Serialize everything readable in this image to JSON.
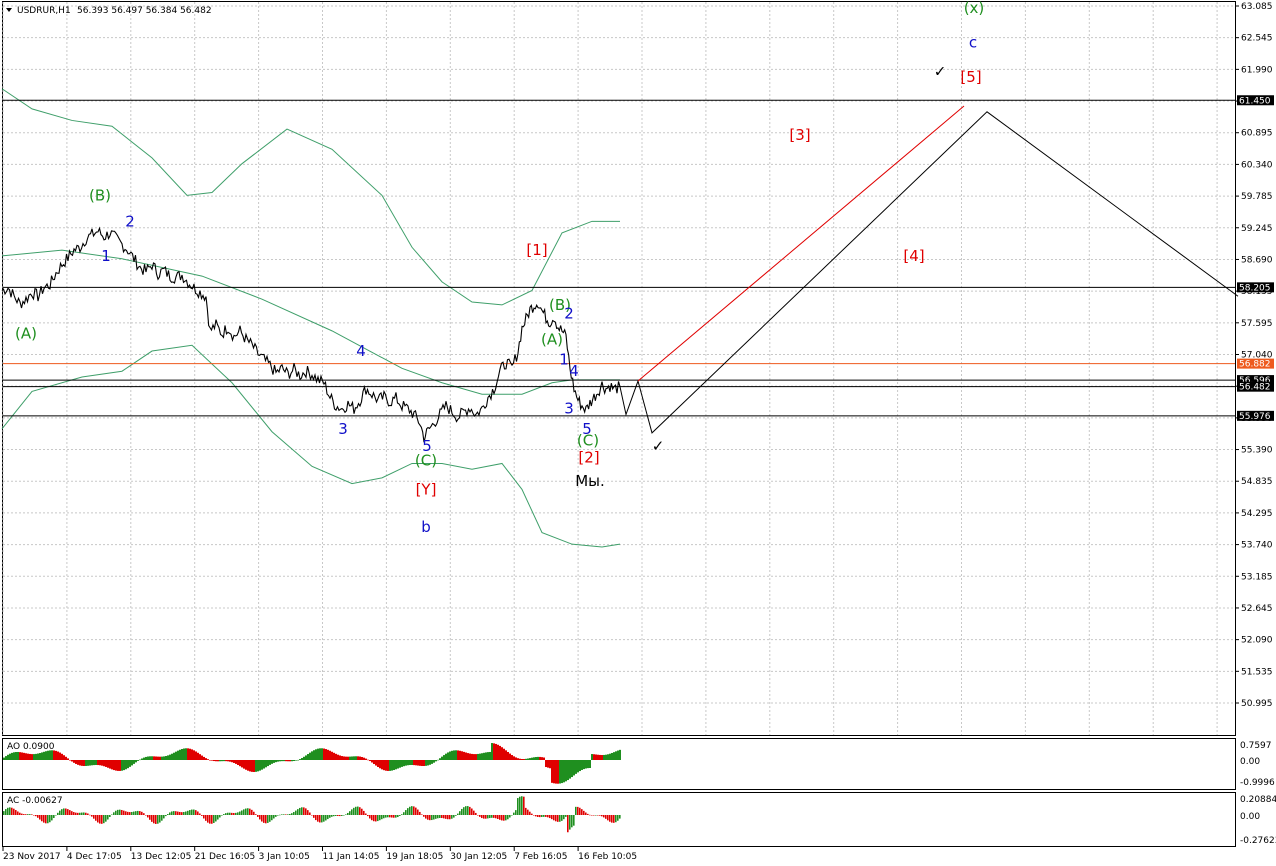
{
  "header": {
    "symbol": "USDRUR,H1",
    "ohlc": "56.393 56.497 56.384 56.482"
  },
  "indicators": {
    "ao": {
      "label": "AO 0.0900",
      "ticks": [
        "0.7597",
        "0.00",
        "-0.9996"
      ]
    },
    "ac": {
      "label": "AC -0.00627",
      "ticks": [
        "0.20884",
        "0.00",
        "-0.27623"
      ]
    }
  },
  "colors": {
    "grid": "#c8c8c8",
    "price": "#000000",
    "bands": "#3f9f6a",
    "orange_level": "#ee5a1e",
    "red_path": "#e00000",
    "blue": "#1010c8",
    "green": "#1f8f1f",
    "red_label": "#e00000",
    "hist_up": "#1f8f1f",
    "hist_down": "#e00000"
  },
  "chart_data": {
    "type": "line",
    "price_axis_ticks": [
      "63.085",
      "62.545",
      "61.990",
      "61.450",
      "60.895",
      "60.340",
      "59.785",
      "59.245",
      "58.690",
      "58.135",
      "57.595",
      "57.040",
      "56.485",
      "55.930",
      "55.390",
      "54.835",
      "54.295",
      "53.740",
      "53.185",
      "52.645",
      "52.090",
      "51.535",
      "50.995"
    ],
    "ylim": [
      50.995,
      63.085
    ],
    "time_axis_ticks": [
      "23 Nov 2017",
      "4 Dec 17:05",
      "13 Dec 12:05",
      "21 Dec 16:05",
      "3 Jan 10:05",
      "11 Jan 14:05",
      "19 Jan 18:05",
      "30 Jan 12:05",
      "7 Feb 16:05",
      "16 Feb 10:05"
    ],
    "levels": [
      {
        "price": 61.45,
        "label": "61.450",
        "color": "#000000",
        "dark_tag": true
      },
      {
        "price": 58.205,
        "label": "58.205",
        "color": "#000000",
        "dark_tag": true
      },
      {
        "price": 56.882,
        "label": "56.882",
        "color": "#ee5a1e",
        "dark_tag": false
      },
      {
        "price": 56.596,
        "label": "56.596",
        "color": "#000000",
        "dark_tag": true
      },
      {
        "price": 56.482,
        "label": "56.482",
        "color": "#000000",
        "dark_tag": true
      },
      {
        "price": 55.976,
        "label": "55.976",
        "color": "#000000",
        "dark_tag": true
      }
    ],
    "price_series": [
      [
        0,
        58.15
      ],
      [
        6,
        58.2
      ],
      [
        12,
        58.05
      ],
      [
        18,
        57.92
      ],
      [
        24,
        58.0
      ],
      [
        30,
        58.12
      ],
      [
        36,
        58.05
      ],
      [
        42,
        58.2
      ],
      [
        48,
        58.25
      ],
      [
        54,
        58.45
      ],
      [
        60,
        58.6
      ],
      [
        66,
        58.72
      ],
      [
        72,
        58.85
      ],
      [
        78,
        58.9
      ],
      [
        84,
        59.05
      ],
      [
        90,
        59.12
      ],
      [
        96,
        59.18
      ],
      [
        102,
        59.08
      ],
      [
        108,
        59.15
      ],
      [
        114,
        59.05
      ],
      [
        120,
        58.95
      ],
      [
        126,
        58.85
      ],
      [
        132,
        58.7
      ],
      [
        138,
        58.55
      ],
      [
        144,
        58.48
      ],
      [
        150,
        58.6
      ],
      [
        156,
        58.45
      ],
      [
        162,
        58.5
      ],
      [
        168,
        58.4
      ],
      [
        174,
        58.38
      ],
      [
        180,
        58.42
      ],
      [
        186,
        58.3
      ],
      [
        192,
        58.2
      ],
      [
        198,
        58.12
      ],
      [
        204,
        58.05
      ],
      [
        208,
        57.45
      ],
      [
        214,
        57.55
      ],
      [
        220,
        57.4
      ],
      [
        226,
        57.52
      ],
      [
        232,
        57.35
      ],
      [
        238,
        57.45
      ],
      [
        244,
        57.3
      ],
      [
        250,
        57.2
      ],
      [
        256,
        57.05
      ],
      [
        262,
        56.95
      ],
      [
        268,
        56.85
      ],
      [
        274,
        56.72
      ],
      [
        280,
        56.8
      ],
      [
        286,
        56.7
      ],
      [
        292,
        56.78
      ],
      [
        298,
        56.68
      ],
      [
        304,
        56.75
      ],
      [
        310,
        56.7
      ],
      [
        316,
        56.6
      ],
      [
        322,
        56.55
      ],
      [
        328,
        56.3
      ],
      [
        334,
        56.15
      ],
      [
        340,
        56.1
      ],
      [
        346,
        56.18
      ],
      [
        352,
        56.1
      ],
      [
        358,
        56.25
      ],
      [
        364,
        56.45
      ],
      [
        370,
        56.35
      ],
      [
        376,
        56.25
      ],
      [
        382,
        56.3
      ],
      [
        388,
        56.22
      ],
      [
        394,
        56.28
      ],
      [
        400,
        56.15
      ],
      [
        406,
        56.1
      ],
      [
        412,
        56.0
      ],
      [
        418,
        55.85
      ],
      [
        422,
        55.6
      ],
      [
        426,
        55.72
      ],
      [
        432,
        55.85
      ],
      [
        438,
        56.0
      ],
      [
        444,
        56.15
      ],
      [
        450,
        56.05
      ],
      [
        456,
        55.95
      ],
      [
        462,
        56.05
      ],
      [
        468,
        56.12
      ],
      [
        474,
        56.0
      ],
      [
        480,
        56.1
      ],
      [
        486,
        56.3
      ],
      [
        492,
        56.45
      ],
      [
        498,
        56.75
      ],
      [
        504,
        56.9
      ],
      [
        510,
        56.8
      ],
      [
        516,
        57.1
      ],
      [
        520,
        57.5
      ],
      [
        524,
        57.65
      ],
      [
        528,
        57.82
      ],
      [
        532,
        57.9
      ],
      [
        536,
        57.95
      ],
      [
        540,
        57.8
      ],
      [
        544,
        57.68
      ],
      [
        548,
        57.6
      ],
      [
        552,
        57.7
      ],
      [
        556,
        57.52
      ],
      [
        560,
        57.45
      ],
      [
        564,
        57.35
      ],
      [
        568,
        56.8
      ],
      [
        572,
        56.45
      ],
      [
        576,
        56.25
      ],
      [
        580,
        56.15
      ],
      [
        584,
        56.08
      ],
      [
        588,
        56.2
      ],
      [
        592,
        56.3
      ],
      [
        596,
        56.4
      ],
      [
        600,
        56.52
      ],
      [
        604,
        56.45
      ],
      [
        608,
        56.5
      ],
      [
        612,
        56.44
      ],
      [
        618,
        56.48
      ]
    ],
    "bands": {
      "upper": [
        [
          0,
          61.65
        ],
        [
          30,
          61.3
        ],
        [
          70,
          61.1
        ],
        [
          110,
          61.0
        ],
        [
          150,
          60.45
        ],
        [
          185,
          59.8
        ],
        [
          210,
          59.85
        ],
        [
          240,
          60.35
        ],
        [
          285,
          60.95
        ],
        [
          330,
          60.6
        ],
        [
          380,
          59.8
        ],
        [
          410,
          58.9
        ],
        [
          440,
          58.3
        ],
        [
          470,
          57.95
        ],
        [
          500,
          57.9
        ],
        [
          530,
          58.15
        ],
        [
          560,
          59.15
        ],
        [
          590,
          59.35
        ],
        [
          618,
          59.35
        ]
      ],
      "middle": [
        [
          0,
          58.75
        ],
        [
          60,
          58.85
        ],
        [
          120,
          58.7
        ],
        [
          200,
          58.4
        ],
        [
          260,
          58.0
        ],
        [
          330,
          57.45
        ],
        [
          400,
          56.8
        ],
        [
          440,
          56.55
        ],
        [
          480,
          56.35
        ],
        [
          520,
          56.35
        ],
        [
          550,
          56.55
        ],
        [
          570,
          56.6
        ],
        [
          590,
          56.6
        ],
        [
          618,
          56.6
        ]
      ],
      "lower": [
        [
          0,
          55.75
        ],
        [
          30,
          56.4
        ],
        [
          80,
          56.65
        ],
        [
          120,
          56.75
        ],
        [
          150,
          57.1
        ],
        [
          190,
          57.2
        ],
        [
          230,
          56.55
        ],
        [
          270,
          55.7
        ],
        [
          310,
          55.1
        ],
        [
          350,
          54.8
        ],
        [
          380,
          54.9
        ],
        [
          410,
          55.15
        ],
        [
          440,
          55.15
        ],
        [
          470,
          55.05
        ],
        [
          500,
          55.15
        ],
        [
          520,
          54.7
        ],
        [
          540,
          53.95
        ],
        [
          570,
          53.75
        ],
        [
          600,
          53.7
        ],
        [
          618,
          53.75
        ]
      ]
    },
    "projection_black": [
      [
        618,
        56.48
      ],
      [
        624,
        56.0
      ],
      [
        636,
        56.58
      ],
      [
        650,
        55.68
      ],
      [
        985,
        61.25
      ],
      [
        1236,
        58.05
      ]
    ],
    "projection_red": [
      [
        636,
        56.58
      ],
      [
        962,
        61.35
      ]
    ],
    "wave_labels": [
      {
        "text": "(A)",
        "x": 24,
        "price": 57.4,
        "color": "green"
      },
      {
        "text": "(B)",
        "x": 98,
        "price": 59.8,
        "color": "green"
      },
      {
        "text": "1",
        "x": 104,
        "price": 58.75,
        "color": "blue"
      },
      {
        "text": "2",
        "x": 128,
        "price": 59.35,
        "color": "blue"
      },
      {
        "text": "3",
        "x": 341,
        "price": 55.75,
        "color": "blue"
      },
      {
        "text": "4",
        "x": 359,
        "price": 57.1,
        "color": "blue"
      },
      {
        "text": "5",
        "x": 425,
        "price": 55.45,
        "color": "blue"
      },
      {
        "text": "(C)",
        "x": 424,
        "price": 55.2,
        "color": "green"
      },
      {
        "text": "[Y]",
        "x": 424,
        "price": 54.7,
        "color": "red"
      },
      {
        "text": "b",
        "x": 424,
        "price": 54.05,
        "color": "blue"
      },
      {
        "text": "[1]",
        "x": 535,
        "price": 58.85,
        "color": "red"
      },
      {
        "text": "(B)",
        "x": 558,
        "price": 57.9,
        "color": "green"
      },
      {
        "text": "2",
        "x": 567,
        "price": 57.75,
        "color": "blue"
      },
      {
        "text": "(A)",
        "x": 550,
        "price": 57.3,
        "color": "green"
      },
      {
        "text": "1",
        "x": 562,
        "price": 56.95,
        "color": "blue"
      },
      {
        "text": "4",
        "x": 572,
        "price": 56.75,
        "color": "blue"
      },
      {
        "text": "3",
        "x": 567,
        "price": 56.1,
        "color": "blue"
      },
      {
        "text": "5",
        "x": 585,
        "price": 55.75,
        "color": "blue"
      },
      {
        "text": "(C)",
        "x": 586,
        "price": 55.55,
        "color": "green"
      },
      {
        "text": "[2]",
        "x": 587,
        "price": 55.25,
        "color": "red"
      },
      {
        "text": "Мы.",
        "x": 588,
        "price": 54.85,
        "color": "black"
      },
      {
        "text": "[3]",
        "x": 798,
        "price": 60.85,
        "color": "red"
      },
      {
        "text": "[4]",
        "x": 912,
        "price": 58.75,
        "color": "red"
      },
      {
        "text": "[5]",
        "x": 969,
        "price": 61.85,
        "color": "red"
      },
      {
        "text": "c",
        "x": 971,
        "price": 62.45,
        "color": "blue"
      },
      {
        "text": "(x)",
        "x": 972,
        "price": 63.05,
        "color": "green"
      },
      {
        "text": "✓",
        "x": 938,
        "price": 61.95,
        "color": "black"
      },
      {
        "text": "✓",
        "x": 656,
        "price": 55.45,
        "color": "black"
      }
    ]
  }
}
